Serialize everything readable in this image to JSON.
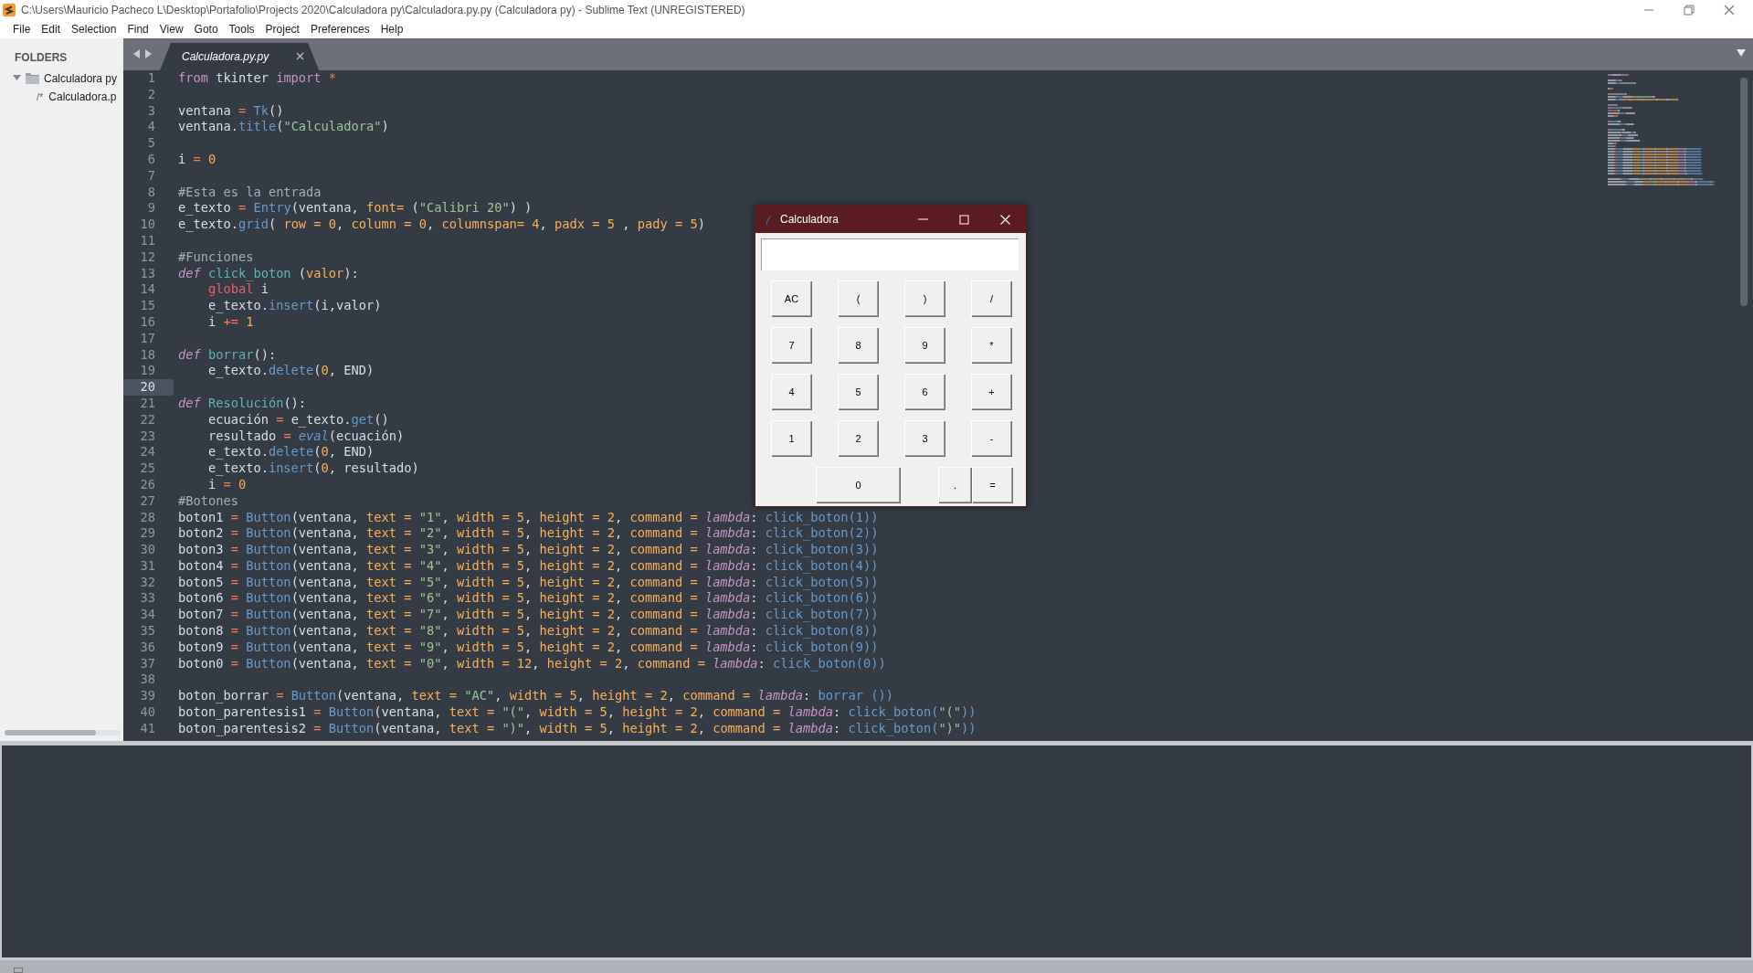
{
  "window": {
    "title": "C:\\Users\\Mauricio Pacheco L\\Desktop\\Portafolio\\Projects 2020\\Calculadora py\\Calculadora.py.py (Calculadora py) - Sublime Text (UNREGISTERED)"
  },
  "menu": [
    "File",
    "Edit",
    "Selection",
    "Find",
    "View",
    "Goto",
    "Tools",
    "Project",
    "Preferences",
    "Help"
  ],
  "sidebar": {
    "heading": "FOLDERS",
    "tree": [
      {
        "label": "Calculadora py",
        "expanded": true,
        "children": [
          {
            "label": "Calculadora.p",
            "glyph": "/*"
          }
        ]
      }
    ]
  },
  "tabs": [
    {
      "label": "Calculadora.py.py",
      "selected": true
    }
  ],
  "editor": {
    "lines": [
      {
        "number": "1",
        "current": false,
        "tokens": [
          {
            "kind": "keyword",
            "text": "from"
          },
          {
            "kind": "plain",
            "text": " tkinter "
          },
          {
            "kind": "keyword",
            "text": "import"
          },
          {
            "kind": "operator",
            "text": " *"
          }
        ]
      },
      {
        "number": "2",
        "current": false
      },
      {
        "number": "3",
        "current": false,
        "tokens": [
          {
            "kind": "plain",
            "text": "ventana "
          },
          {
            "kind": "operator",
            "text": "= "
          },
          {
            "kind": "call",
            "text": "Tk"
          },
          {
            "kind": "plain",
            "text": "()"
          }
        ]
      },
      {
        "number": "4",
        "current": false,
        "tokens": [
          {
            "kind": "plain",
            "text": "ventana."
          },
          {
            "kind": "call",
            "text": "title"
          },
          {
            "kind": "plain",
            "text": "("
          },
          {
            "kind": "string",
            "text": "\"Calculadora\""
          },
          {
            "kind": "plain",
            "text": ")"
          }
        ]
      },
      {
        "number": "5",
        "current": false
      },
      {
        "number": "6",
        "current": false,
        "tokens": [
          {
            "kind": "plain",
            "text": "i "
          },
          {
            "kind": "operator",
            "text": "= "
          },
          {
            "kind": "number",
            "text": "0"
          }
        ]
      },
      {
        "number": "7",
        "current": false
      },
      {
        "number": "8",
        "current": false,
        "tokens": [
          {
            "kind": "comment",
            "text": "#Esta es la entrada"
          }
        ]
      },
      {
        "number": "9",
        "current": false,
        "tokens": [
          {
            "kind": "plain",
            "text": "e_texto "
          },
          {
            "kind": "operator",
            "text": "= "
          },
          {
            "kind": "call",
            "text": "Entry"
          },
          {
            "kind": "plain",
            "text": "(ventana, "
          },
          {
            "kind": "argument",
            "text": "font= "
          },
          {
            "kind": "plain",
            "text": "("
          },
          {
            "kind": "string",
            "text": "\"Calibri 20\""
          },
          {
            "kind": "plain",
            "text": ") )"
          }
        ]
      },
      {
        "number": "10",
        "current": false,
        "tokens": [
          {
            "kind": "plain",
            "text": "e_texto."
          },
          {
            "kind": "call",
            "text": "grid"
          },
          {
            "kind": "plain",
            "text": "( "
          },
          {
            "kind": "argument",
            "text": "row = 0"
          },
          {
            "kind": "plain",
            "text": ", "
          },
          {
            "kind": "argument",
            "text": "column = 0"
          },
          {
            "kind": "plain",
            "text": ", "
          },
          {
            "kind": "argument",
            "text": "columnspan= 4"
          },
          {
            "kind": "plain",
            "text": ", "
          },
          {
            "kind": "argument",
            "text": "padx = 5"
          },
          {
            "kind": "plain",
            "text": " , "
          },
          {
            "kind": "argument",
            "text": "pady = 5"
          },
          {
            "kind": "plain",
            "text": ")"
          }
        ]
      },
      {
        "number": "11",
        "current": false
      },
      {
        "number": "12",
        "current": false,
        "tokens": [
          {
            "kind": "comment",
            "text": "#Funciones"
          }
        ]
      },
      {
        "number": "13",
        "current": false,
        "tokens": [
          {
            "kind": "storage",
            "text": "def "
          },
          {
            "kind": "function",
            "text": "click_boton"
          },
          {
            "kind": "plain",
            "text": " ("
          },
          {
            "kind": "argument",
            "text": "valor"
          },
          {
            "kind": "plain",
            "text": "):"
          }
        ]
      },
      {
        "number": "14",
        "current": false,
        "tokens": [
          {
            "kind": "global",
            "text": "    global"
          },
          {
            "kind": "plain",
            "text": " i"
          }
        ]
      },
      {
        "number": "15",
        "current": false,
        "tokens": [
          {
            "kind": "plain",
            "text": "    e_texto."
          },
          {
            "kind": "call",
            "text": "insert"
          },
          {
            "kind": "plain",
            "text": "(i,valor)"
          }
        ]
      },
      {
        "number": "16",
        "current": false,
        "tokens": [
          {
            "kind": "plain",
            "text": "    i "
          },
          {
            "kind": "operator",
            "text": "+= "
          },
          {
            "kind": "number",
            "text": "1"
          }
        ]
      },
      {
        "number": "17",
        "current": false
      },
      {
        "number": "18",
        "current": false,
        "tokens": [
          {
            "kind": "storage",
            "text": "def "
          },
          {
            "kind": "function",
            "text": "borrar"
          },
          {
            "kind": "plain",
            "text": "():"
          }
        ]
      },
      {
        "number": "19",
        "current": false,
        "tokens": [
          {
            "kind": "plain",
            "text": "    e_texto."
          },
          {
            "kind": "call",
            "text": "delete"
          },
          {
            "kind": "plain",
            "text": "("
          },
          {
            "kind": "number",
            "text": "0"
          },
          {
            "kind": "plain",
            "text": ", END)"
          }
        ]
      },
      {
        "number": "20",
        "current": true
      },
      {
        "number": "21",
        "current": false,
        "tokens": [
          {
            "kind": "storage",
            "text": "def "
          },
          {
            "kind": "function",
            "text": "Resolución"
          },
          {
            "kind": "plain",
            "text": "():"
          }
        ]
      },
      {
        "number": "22",
        "current": false,
        "tokens": [
          {
            "kind": "plain",
            "text": "    ecuación "
          },
          {
            "kind": "operator",
            "text": "="
          },
          {
            "kind": "plain",
            "text": " e_texto."
          },
          {
            "kind": "call",
            "text": "get"
          },
          {
            "kind": "plain",
            "text": "()"
          }
        ]
      },
      {
        "number": "23",
        "current": false,
        "tokens": [
          {
            "kind": "plain",
            "text": "    resultado "
          },
          {
            "kind": "operator",
            "text": "= "
          },
          {
            "kind": "builtin",
            "text": "eval"
          },
          {
            "kind": "plain",
            "text": "(ecuación)"
          }
        ]
      },
      {
        "number": "24",
        "current": false,
        "tokens": [
          {
            "kind": "plain",
            "text": "    e_texto."
          },
          {
            "kind": "call",
            "text": "delete"
          },
          {
            "kind": "plain",
            "text": "("
          },
          {
            "kind": "number",
            "text": "0"
          },
          {
            "kind": "plain",
            "text": ", END)"
          }
        ]
      },
      {
        "number": "25",
        "current": false,
        "tokens": [
          {
            "kind": "plain",
            "text": "    e_texto."
          },
          {
            "kind": "call",
            "text": "insert"
          },
          {
            "kind": "plain",
            "text": "("
          },
          {
            "kind": "number",
            "text": "0"
          },
          {
            "kind": "plain",
            "text": ", resultado)"
          }
        ]
      },
      {
        "number": "26",
        "current": false,
        "tokens": [
          {
            "kind": "plain",
            "text": "    i "
          },
          {
            "kind": "operator",
            "text": "= "
          },
          {
            "kind": "number",
            "text": "0"
          }
        ]
      },
      {
        "number": "27",
        "current": false,
        "tokens": [
          {
            "kind": "comment",
            "text": "#Botones"
          }
        ]
      },
      {
        "number": "28",
        "current": false,
        "tokens": [
          {
            "kind": "plain",
            "text": "boton1 "
          },
          {
            "kind": "operator",
            "text": "= "
          },
          {
            "kind": "call",
            "text": "Button"
          },
          {
            "kind": "plain",
            "text": "(ventana, "
          },
          {
            "kind": "argument",
            "text": "text = "
          },
          {
            "kind": "string",
            "text": "\"1\""
          },
          {
            "kind": "plain",
            "text": ", "
          },
          {
            "kind": "argument",
            "text": "width = 5"
          },
          {
            "kind": "plain",
            "text": ", "
          },
          {
            "kind": "argument",
            "text": "height = 2"
          },
          {
            "kind": "plain",
            "text": ", "
          },
          {
            "kind": "argument",
            "text": "command = "
          },
          {
            "kind": "storage",
            "text": "lambda"
          },
          {
            "kind": "plain",
            "text": ": "
          },
          {
            "kind": "call",
            "text": "click_boton(1))"
          }
        ]
      },
      {
        "number": "29",
        "current": false,
        "tokens": [
          {
            "kind": "plain",
            "text": "boton2 "
          },
          {
            "kind": "operator",
            "text": "= "
          },
          {
            "kind": "call",
            "text": "Button"
          },
          {
            "kind": "plain",
            "text": "(ventana, "
          },
          {
            "kind": "argument",
            "text": "text = "
          },
          {
            "kind": "string",
            "text": "\"2\""
          },
          {
            "kind": "plain",
            "text": ", "
          },
          {
            "kind": "argument",
            "text": "width = 5"
          },
          {
            "kind": "plain",
            "text": ", "
          },
          {
            "kind": "argument",
            "text": "height = 2"
          },
          {
            "kind": "plain",
            "text": ", "
          },
          {
            "kind": "argument",
            "text": "command = "
          },
          {
            "kind": "storage",
            "text": "lambda"
          },
          {
            "kind": "plain",
            "text": ": "
          },
          {
            "kind": "call",
            "text": "click_boton(2))"
          }
        ]
      },
      {
        "number": "30",
        "current": false,
        "tokens": [
          {
            "kind": "plain",
            "text": "boton3 "
          },
          {
            "kind": "operator",
            "text": "= "
          },
          {
            "kind": "call",
            "text": "Button"
          },
          {
            "kind": "plain",
            "text": "(ventana, "
          },
          {
            "kind": "argument",
            "text": "text = "
          },
          {
            "kind": "string",
            "text": "\"3\""
          },
          {
            "kind": "plain",
            "text": ", "
          },
          {
            "kind": "argument",
            "text": "width = 5"
          },
          {
            "kind": "plain",
            "text": ", "
          },
          {
            "kind": "argument",
            "text": "height = 2"
          },
          {
            "kind": "plain",
            "text": ", "
          },
          {
            "kind": "argument",
            "text": "command = "
          },
          {
            "kind": "storage",
            "text": "lambda"
          },
          {
            "kind": "plain",
            "text": ": "
          },
          {
            "kind": "call",
            "text": "click_boton(3))"
          }
        ]
      },
      {
        "number": "31",
        "current": false,
        "tokens": [
          {
            "kind": "plain",
            "text": "boton4 "
          },
          {
            "kind": "operator",
            "text": "= "
          },
          {
            "kind": "call",
            "text": "Button"
          },
          {
            "kind": "plain",
            "text": "(ventana, "
          },
          {
            "kind": "argument",
            "text": "text = "
          },
          {
            "kind": "string",
            "text": "\"4\""
          },
          {
            "kind": "plain",
            "text": ", "
          },
          {
            "kind": "argument",
            "text": "width = 5"
          },
          {
            "kind": "plain",
            "text": ", "
          },
          {
            "kind": "argument",
            "text": "height = 2"
          },
          {
            "kind": "plain",
            "text": ", "
          },
          {
            "kind": "argument",
            "text": "command = "
          },
          {
            "kind": "storage",
            "text": "lambda"
          },
          {
            "kind": "plain",
            "text": ": "
          },
          {
            "kind": "call",
            "text": "click_boton(4))"
          }
        ]
      },
      {
        "number": "32",
        "current": false,
        "tokens": [
          {
            "kind": "plain",
            "text": "boton5 "
          },
          {
            "kind": "operator",
            "text": "= "
          },
          {
            "kind": "call",
            "text": "Button"
          },
          {
            "kind": "plain",
            "text": "(ventana, "
          },
          {
            "kind": "argument",
            "text": "text = "
          },
          {
            "kind": "string",
            "text": "\"5\""
          },
          {
            "kind": "plain",
            "text": ", "
          },
          {
            "kind": "argument",
            "text": "width = 5"
          },
          {
            "kind": "plain",
            "text": ", "
          },
          {
            "kind": "argument",
            "text": "height = 2"
          },
          {
            "kind": "plain",
            "text": ", "
          },
          {
            "kind": "argument",
            "text": "command = "
          },
          {
            "kind": "storage",
            "text": "lambda"
          },
          {
            "kind": "plain",
            "text": ": "
          },
          {
            "kind": "call",
            "text": "click_boton(5))"
          }
        ]
      },
      {
        "number": "33",
        "current": false,
        "tokens": [
          {
            "kind": "plain",
            "text": "boton6 "
          },
          {
            "kind": "operator",
            "text": "= "
          },
          {
            "kind": "call",
            "text": "Button"
          },
          {
            "kind": "plain",
            "text": "(ventana, "
          },
          {
            "kind": "argument",
            "text": "text = "
          },
          {
            "kind": "string",
            "text": "\"6\""
          },
          {
            "kind": "plain",
            "text": ", "
          },
          {
            "kind": "argument",
            "text": "width = 5"
          },
          {
            "kind": "plain",
            "text": ", "
          },
          {
            "kind": "argument",
            "text": "height = 2"
          },
          {
            "kind": "plain",
            "text": ", "
          },
          {
            "kind": "argument",
            "text": "command = "
          },
          {
            "kind": "storage",
            "text": "lambda"
          },
          {
            "kind": "plain",
            "text": ": "
          },
          {
            "kind": "call",
            "text": "click_boton(6))"
          }
        ]
      },
      {
        "number": "34",
        "current": false,
        "tokens": [
          {
            "kind": "plain",
            "text": "boton7 "
          },
          {
            "kind": "operator",
            "text": "= "
          },
          {
            "kind": "call",
            "text": "Button"
          },
          {
            "kind": "plain",
            "text": "(ventana, "
          },
          {
            "kind": "argument",
            "text": "text = "
          },
          {
            "kind": "string",
            "text": "\"7\""
          },
          {
            "kind": "plain",
            "text": ", "
          },
          {
            "kind": "argument",
            "text": "width = 5"
          },
          {
            "kind": "plain",
            "text": ", "
          },
          {
            "kind": "argument",
            "text": "height = 2"
          },
          {
            "kind": "plain",
            "text": ", "
          },
          {
            "kind": "argument",
            "text": "command = "
          },
          {
            "kind": "storage",
            "text": "lambda"
          },
          {
            "kind": "plain",
            "text": ": "
          },
          {
            "kind": "call",
            "text": "click_boton(7))"
          }
        ]
      },
      {
        "number": "35",
        "current": false,
        "tokens": [
          {
            "kind": "plain",
            "text": "boton8 "
          },
          {
            "kind": "operator",
            "text": "= "
          },
          {
            "kind": "call",
            "text": "Button"
          },
          {
            "kind": "plain",
            "text": "(ventana, "
          },
          {
            "kind": "argument",
            "text": "text = "
          },
          {
            "kind": "string",
            "text": "\"8\""
          },
          {
            "kind": "plain",
            "text": ", "
          },
          {
            "kind": "argument",
            "text": "width = 5"
          },
          {
            "kind": "plain",
            "text": ", "
          },
          {
            "kind": "argument",
            "text": "height = 2"
          },
          {
            "kind": "plain",
            "text": ", "
          },
          {
            "kind": "argument",
            "text": "command = "
          },
          {
            "kind": "storage",
            "text": "lambda"
          },
          {
            "kind": "plain",
            "text": ": "
          },
          {
            "kind": "call",
            "text": "click_boton(8))"
          }
        ]
      },
      {
        "number": "36",
        "current": false,
        "tokens": [
          {
            "kind": "plain",
            "text": "boton9 "
          },
          {
            "kind": "operator",
            "text": "= "
          },
          {
            "kind": "call",
            "text": "Button"
          },
          {
            "kind": "plain",
            "text": "(ventana, "
          },
          {
            "kind": "argument",
            "text": "text = "
          },
          {
            "kind": "string",
            "text": "\"9\""
          },
          {
            "kind": "plain",
            "text": ", "
          },
          {
            "kind": "argument",
            "text": "width = 5"
          },
          {
            "kind": "plain",
            "text": ", "
          },
          {
            "kind": "argument",
            "text": "height = 2"
          },
          {
            "kind": "plain",
            "text": ", "
          },
          {
            "kind": "argument",
            "text": "command = "
          },
          {
            "kind": "storage",
            "text": "lambda"
          },
          {
            "kind": "plain",
            "text": ": "
          },
          {
            "kind": "call",
            "text": "click_boton(9))"
          }
        ]
      },
      {
        "number": "37",
        "current": false,
        "tokens": [
          {
            "kind": "plain",
            "text": "boton0 "
          },
          {
            "kind": "operator",
            "text": "= "
          },
          {
            "kind": "call",
            "text": "Button"
          },
          {
            "kind": "plain",
            "text": "(ventana, "
          },
          {
            "kind": "argument",
            "text": "text = "
          },
          {
            "kind": "string",
            "text": "\"0\""
          },
          {
            "kind": "plain",
            "text": ", "
          },
          {
            "kind": "argument",
            "text": "width = 12"
          },
          {
            "kind": "plain",
            "text": ", "
          },
          {
            "kind": "argument",
            "text": "height = 2"
          },
          {
            "kind": "plain",
            "text": ", "
          },
          {
            "kind": "argument",
            "text": "command = "
          },
          {
            "kind": "storage",
            "text": "lambda"
          },
          {
            "kind": "plain",
            "text": ": "
          },
          {
            "kind": "call",
            "text": "click_boton(0))"
          }
        ]
      },
      {
        "number": "38",
        "current": false
      },
      {
        "number": "39",
        "current": false,
        "tokens": [
          {
            "kind": "plain",
            "text": "boton_borrar "
          },
          {
            "kind": "operator",
            "text": "= "
          },
          {
            "kind": "call",
            "text": "Button"
          },
          {
            "kind": "plain",
            "text": "(ventana, "
          },
          {
            "kind": "argument",
            "text": "text = "
          },
          {
            "kind": "string",
            "text": "\"AC\""
          },
          {
            "kind": "plain",
            "text": ", "
          },
          {
            "kind": "argument",
            "text": "width = 5"
          },
          {
            "kind": "plain",
            "text": ", "
          },
          {
            "kind": "argument",
            "text": "height = 2"
          },
          {
            "kind": "plain",
            "text": ", "
          },
          {
            "kind": "argument",
            "text": "command = "
          },
          {
            "kind": "storage",
            "text": "lambda"
          },
          {
            "kind": "plain",
            "text": ": "
          },
          {
            "kind": "call",
            "text": "borrar ())"
          }
        ]
      },
      {
        "number": "40",
        "current": false,
        "tokens": [
          {
            "kind": "plain",
            "text": "boton_parentesis1 "
          },
          {
            "kind": "operator",
            "text": "= "
          },
          {
            "kind": "call",
            "text": "Button"
          },
          {
            "kind": "plain",
            "text": "(ventana, "
          },
          {
            "kind": "argument",
            "text": "text = "
          },
          {
            "kind": "string",
            "text": "\"(\""
          },
          {
            "kind": "plain",
            "text": ", "
          },
          {
            "kind": "argument",
            "text": "width = 5"
          },
          {
            "kind": "plain",
            "text": ", "
          },
          {
            "kind": "argument",
            "text": "height = 2"
          },
          {
            "kind": "plain",
            "text": ", "
          },
          {
            "kind": "argument",
            "text": "command = "
          },
          {
            "kind": "storage",
            "text": "lambda"
          },
          {
            "kind": "plain",
            "text": ": "
          },
          {
            "kind": "call",
            "text": "click_boton("
          },
          {
            "kind": "string",
            "text": "\"(\""
          },
          {
            "kind": "call",
            "text": "))"
          }
        ]
      },
      {
        "number": "41",
        "current": false,
        "tokens": [
          {
            "kind": "plain",
            "text": "boton_parentesis2 "
          },
          {
            "kind": "operator",
            "text": "= "
          },
          {
            "kind": "call",
            "text": "Button"
          },
          {
            "kind": "plain",
            "text": "(ventana, "
          },
          {
            "kind": "argument",
            "text": "text = "
          },
          {
            "kind": "string",
            "text": "\")\""
          },
          {
            "kind": "plain",
            "text": ", "
          },
          {
            "kind": "argument",
            "text": "width = 5"
          },
          {
            "kind": "plain",
            "text": ", "
          },
          {
            "kind": "argument",
            "text": "height = 2"
          },
          {
            "kind": "plain",
            "text": ", "
          },
          {
            "kind": "argument",
            "text": "command = "
          },
          {
            "kind": "storage",
            "text": "lambda"
          },
          {
            "kind": "plain",
            "text": ": "
          },
          {
            "kind": "call",
            "text": "click_boton("
          },
          {
            "kind": "string",
            "text": "\")\""
          },
          {
            "kind": "call",
            "text": "))"
          }
        ]
      }
    ]
  },
  "calculator": {
    "title": "Calculadora",
    "rows": [
      [
        {
          "label": "AC",
          "kind": "key"
        },
        {
          "label": "(",
          "kind": "key"
        },
        {
          "label": ")",
          "kind": "key"
        },
        {
          "label": "/",
          "kind": "key"
        }
      ],
      [
        {
          "label": "7",
          "kind": "key"
        },
        {
          "label": "8",
          "kind": "key"
        },
        {
          "label": "9",
          "kind": "key"
        },
        {
          "label": "*",
          "kind": "key"
        }
      ],
      [
        {
          "label": "4",
          "kind": "key"
        },
        {
          "label": "5",
          "kind": "key"
        },
        {
          "label": "6",
          "kind": "key"
        },
        {
          "label": "+",
          "kind": "key"
        }
      ],
      [
        {
          "label": "1",
          "kind": "key"
        },
        {
          "label": "2",
          "kind": "key"
        },
        {
          "label": "3",
          "kind": "key"
        },
        {
          "label": "-",
          "kind": "key"
        }
      ],
      [
        {
          "kind": "blank"
        },
        {
          "label": "0",
          "kind": "wide"
        },
        {
          "label": ".",
          "kind": "narrow"
        },
        {
          "label": "=",
          "kind": "key"
        }
      ]
    ]
  }
}
